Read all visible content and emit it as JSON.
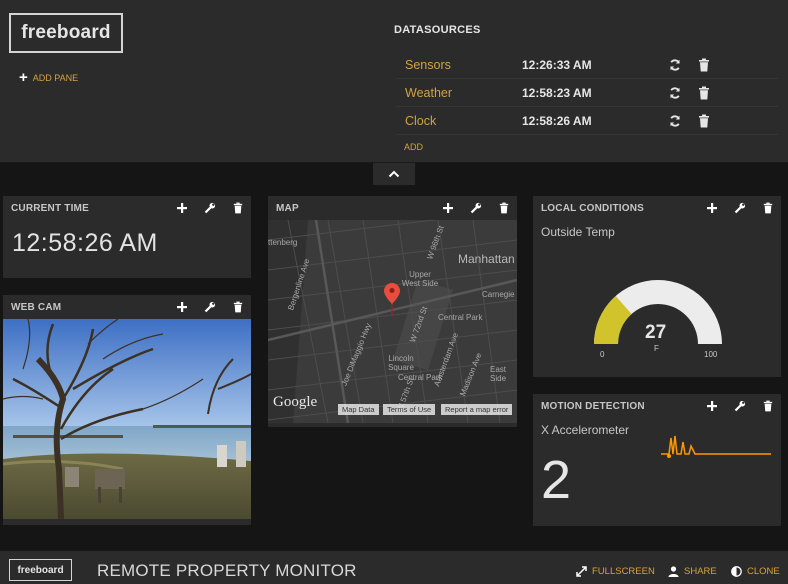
{
  "header": {
    "logo": "freeboard",
    "add_pane": "ADD PANE",
    "datasources_title": "DATASOURCES",
    "datasources": [
      {
        "name": "Sensors",
        "time": "12:26:33 AM"
      },
      {
        "name": "Weather",
        "time": "12:58:23 AM"
      },
      {
        "name": "Clock",
        "time": "12:58:26 AM"
      }
    ],
    "add": "ADD"
  },
  "panes": {
    "current_time": {
      "title": "CURRENT TIME",
      "value": "12:58:26 AM"
    },
    "web_cam": {
      "title": "WEB CAM"
    },
    "map": {
      "title": "MAP",
      "labels": [
        "Manhattan",
        "Upper West Side",
        "Central Park",
        "Lincoln Square",
        "Carnegie",
        "W 96th St",
        "W 72nd St",
        "W 57th St",
        "Joe DiMaggio Hwy",
        "Central Park",
        "Madison Ave",
        "East Side",
        "ttenberg",
        "Bergenline Ave",
        "Amsterdam Ave"
      ],
      "google": "Google",
      "footer": [
        "Map Data",
        "Terms of Use",
        "Report a map error"
      ]
    },
    "local_conditions": {
      "title": "LOCAL CONDITIONS",
      "label": "Outside Temp",
      "gauge": {
        "value": 27,
        "unit": "F",
        "min": 0,
        "max": 100,
        "fill_color": "#d0c32c",
        "track_color": "#ececec"
      }
    },
    "motion_detection": {
      "title": "MOTION DETECTION",
      "label": "X Accelerometer",
      "value": "2",
      "sparkline_color": "#ff9900"
    }
  },
  "footer": {
    "logo": "freeboard",
    "title": "REMOTE PROPERTY MONITOR",
    "fullscreen": "FULLSCREEN",
    "share": "SHARE",
    "clone": "CLONE"
  },
  "colors": {
    "accent": "#d3a340",
    "panel": "#2b2b2b",
    "background": "#151515"
  }
}
